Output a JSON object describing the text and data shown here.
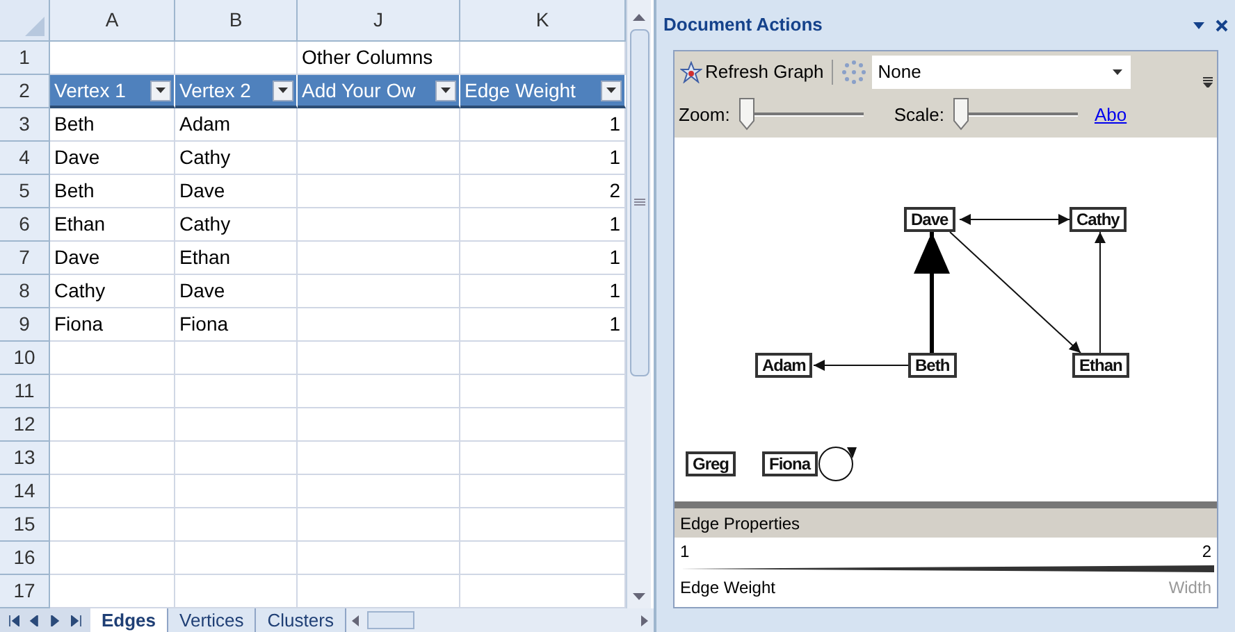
{
  "sheet": {
    "columns": [
      "A",
      "B",
      "J",
      "K"
    ],
    "group_row": {
      "number": "1",
      "label": "Other Columns"
    },
    "header_row": {
      "number": "2",
      "headers": [
        "Vertex 1",
        "Vertex 2",
        "Add Your Ow",
        "Edge Weight"
      ]
    },
    "data_rows": [
      {
        "number": "3",
        "vertex_1": "Beth",
        "vertex_2": "Adam",
        "edge_weight": "1"
      },
      {
        "number": "4",
        "vertex_1": "Dave",
        "vertex_2": "Cathy",
        "edge_weight": "1"
      },
      {
        "number": "5",
        "vertex_1": "Beth",
        "vertex_2": "Dave",
        "edge_weight": "2"
      },
      {
        "number": "6",
        "vertex_1": "Ethan",
        "vertex_2": "Cathy",
        "edge_weight": "1"
      },
      {
        "number": "7",
        "vertex_1": "Dave",
        "vertex_2": "Ethan",
        "edge_weight": "1"
      },
      {
        "number": "8",
        "vertex_1": "Cathy",
        "vertex_2": "Dave",
        "edge_weight": "1"
      },
      {
        "number": "9",
        "vertex_1": "Fiona",
        "vertex_2": "Fiona",
        "edge_weight": "1"
      }
    ],
    "empty_rows": [
      "10",
      "11",
      "12",
      "13",
      "14",
      "15",
      "16",
      "17"
    ],
    "tabs": [
      {
        "label": "Edges",
        "selected": true
      },
      {
        "label": "Vertices",
        "selected": false
      },
      {
        "label": "Clusters",
        "selected": false
      }
    ]
  },
  "pane": {
    "title": "Document Actions",
    "toolbar": {
      "refresh_button": "Refresh Graph",
      "layout_select": "None"
    },
    "zoom": {
      "label": "Zoom:",
      "level": 0.05
    },
    "scale": {
      "label": "Scale:",
      "level": 0.05
    },
    "link": "Abo",
    "graph": {
      "nodes": [
        "Dave",
        "Cathy",
        "Adam",
        "Beth",
        "Ethan",
        "Greg",
        "Fiona"
      ]
    },
    "edge_properties": {
      "title": "Edge Properties",
      "min": "1",
      "max": "2",
      "property": "Edge Weight",
      "visual": "Width"
    }
  }
}
